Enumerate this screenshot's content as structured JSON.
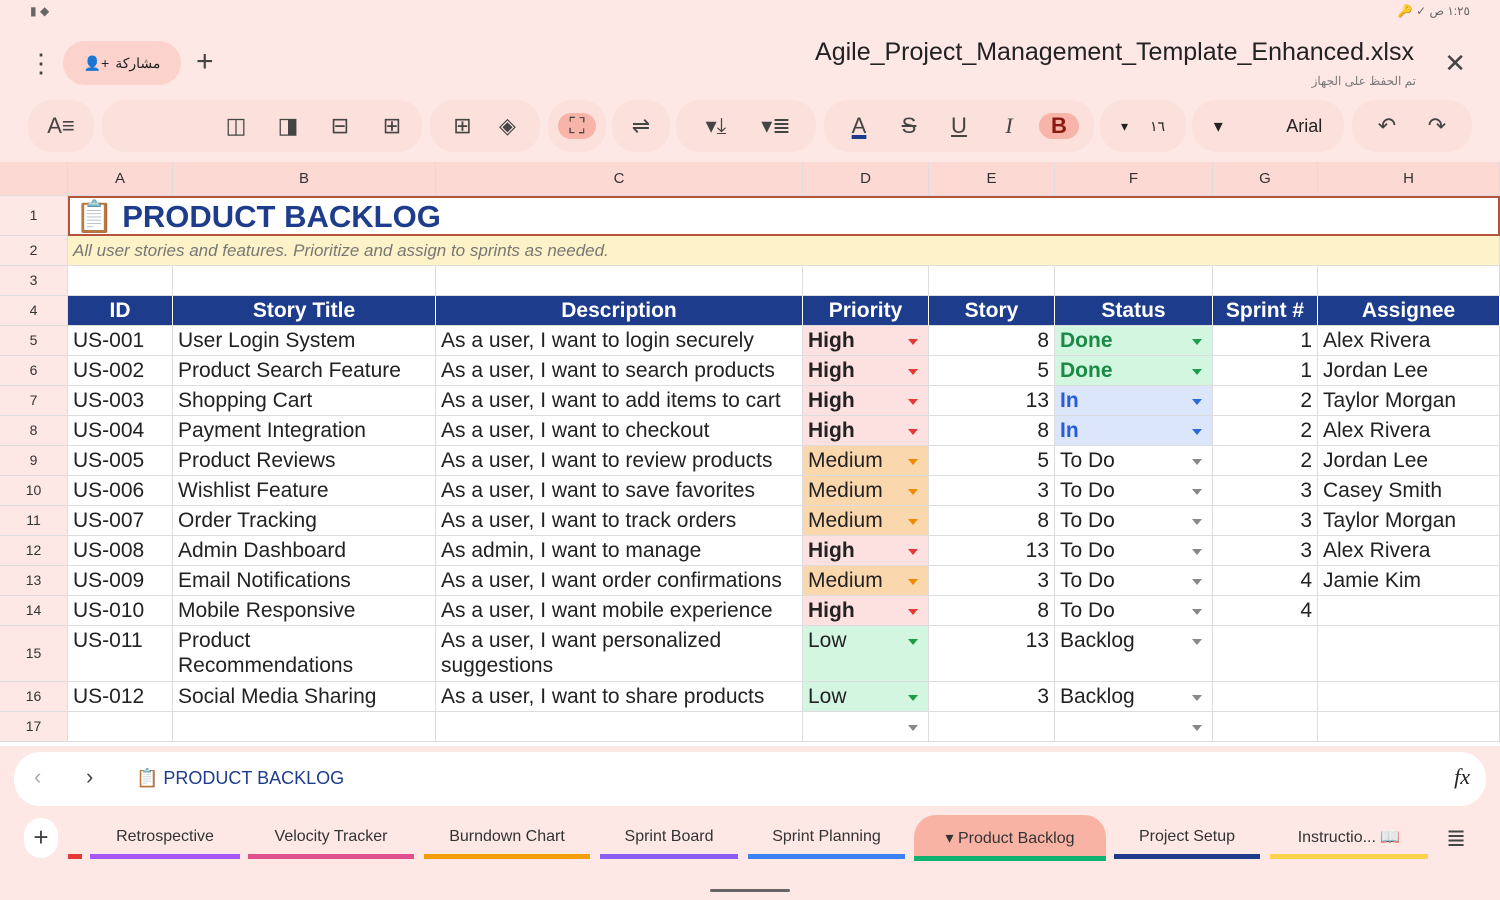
{
  "status_bar": {
    "time": "١:٢٥ ص"
  },
  "header": {
    "title": "Agile_Project_Management_Template_Enhanced.xlsx",
    "saved": "تم الحفظ على الجهاز",
    "share_label": "مشاركة"
  },
  "toolbar": {
    "font_size": "١٦",
    "font": "Arial"
  },
  "columns": [
    "A",
    "B",
    "C",
    "D",
    "E",
    "F",
    "G",
    "H"
  ],
  "sheet": {
    "title": "📋 PRODUCT BACKLOG",
    "subtitle": "All user stories and features. Prioritize and assign to sprints as needed.",
    "headers": [
      "ID",
      "Story Title",
      "Description",
      "Priority",
      "Story",
      "Status",
      "Sprint #",
      "Assignee"
    ],
    "rows": [
      [
        "US-001",
        "User Login System",
        "As a user, I want to login securely",
        "High",
        "8",
        "Done",
        "1",
        "Alex Rivera"
      ],
      [
        "US-002",
        "Product Search Feature",
        "As a user, I want to search products",
        "High",
        "5",
        "Done",
        "1",
        "Jordan Lee"
      ],
      [
        "US-003",
        "Shopping Cart",
        "As a user, I want to add items to cart",
        "High",
        "13",
        "In",
        "2",
        "Taylor Morgan"
      ],
      [
        "US-004",
        "Payment Integration",
        "As a user, I want to checkout",
        "High",
        "8",
        "In",
        "2",
        "Alex Rivera"
      ],
      [
        "US-005",
        "Product Reviews",
        "As a user, I want to review products",
        "Medium",
        "5",
        "To Do",
        "2",
        "Jordan Lee"
      ],
      [
        "US-006",
        "Wishlist Feature",
        "As a user, I want to save favorites",
        "Medium",
        "3",
        "To Do",
        "3",
        "Casey Smith"
      ],
      [
        "US-007",
        "Order Tracking",
        "As a user, I want to track orders",
        "Medium",
        "8",
        "To Do",
        "3",
        "Taylor Morgan"
      ],
      [
        "US-008",
        "Admin Dashboard",
        "As admin, I want to manage",
        "High",
        "13",
        "To Do",
        "3",
        "Alex Rivera"
      ],
      [
        "US-009",
        "Email Notifications",
        "As a user, I want order confirmations",
        "Medium",
        "3",
        "To Do",
        "4",
        "Jamie Kim"
      ],
      [
        "US-010",
        "Mobile Responsive",
        "As a user, I want mobile experience",
        "High",
        "8",
        "To Do",
        "4",
        ""
      ],
      [
        "US-011",
        "Product\nRecommendations",
        "As a user, I want personalized\nsuggestions",
        "Low",
        "13",
        "Backlog",
        "",
        ""
      ],
      [
        "US-012",
        "Social Media Sharing",
        "As a user, I want to share products",
        "Low",
        "3",
        "Backlog",
        "",
        ""
      ]
    ]
  },
  "formula_bar": {
    "cell_content": "📋 PRODUCT BACKLOG"
  },
  "tabs": [
    {
      "label": "Retrospective",
      "color": "#a855f7"
    },
    {
      "label": "Velocity Tracker",
      "color": "#e0508f"
    },
    {
      "label": "Burndown Chart",
      "color": "#f59e0b"
    },
    {
      "label": "Sprint Board",
      "color": "#8b5cf6"
    },
    {
      "label": "Sprint Planning",
      "color": "#3b82f6"
    },
    {
      "label": "▾ Product Backlog",
      "color": "#10b070",
      "active": true
    },
    {
      "label": "Project Setup",
      "color": "#1e3a8a"
    },
    {
      "label": "Instructio... 📖",
      "color": "#fcd34d"
    }
  ]
}
